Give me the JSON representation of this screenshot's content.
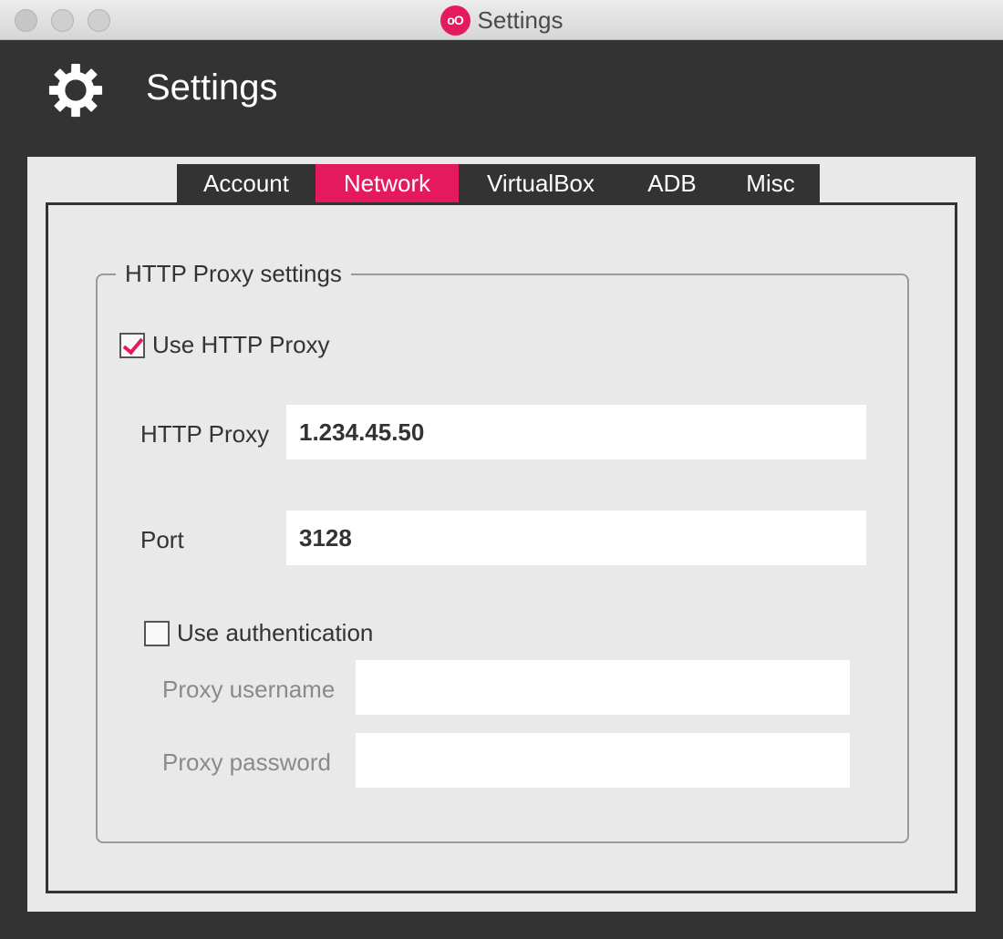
{
  "window": {
    "title": "Settings",
    "app_icon_glyph": "oO",
    "accent": "#e5195e"
  },
  "header": {
    "title": "Settings",
    "icon": "gear-icon"
  },
  "tabs": [
    {
      "label": "Account",
      "active": false
    },
    {
      "label": "Network",
      "active": true
    },
    {
      "label": "VirtualBox",
      "active": false
    },
    {
      "label": "ADB",
      "active": false
    },
    {
      "label": "Misc",
      "active": false
    }
  ],
  "proxy": {
    "group_title": "HTTP Proxy settings",
    "use_proxy_label": "Use HTTP Proxy",
    "use_proxy_checked": true,
    "http_proxy_label": "HTTP Proxy",
    "http_proxy_value": "1.234.45.50",
    "port_label": "Port",
    "port_value": "3128",
    "use_auth_label": "Use authentication",
    "use_auth_checked": false,
    "username_label": "Proxy username",
    "username_value": "",
    "password_label": "Proxy password",
    "password_value": ""
  }
}
